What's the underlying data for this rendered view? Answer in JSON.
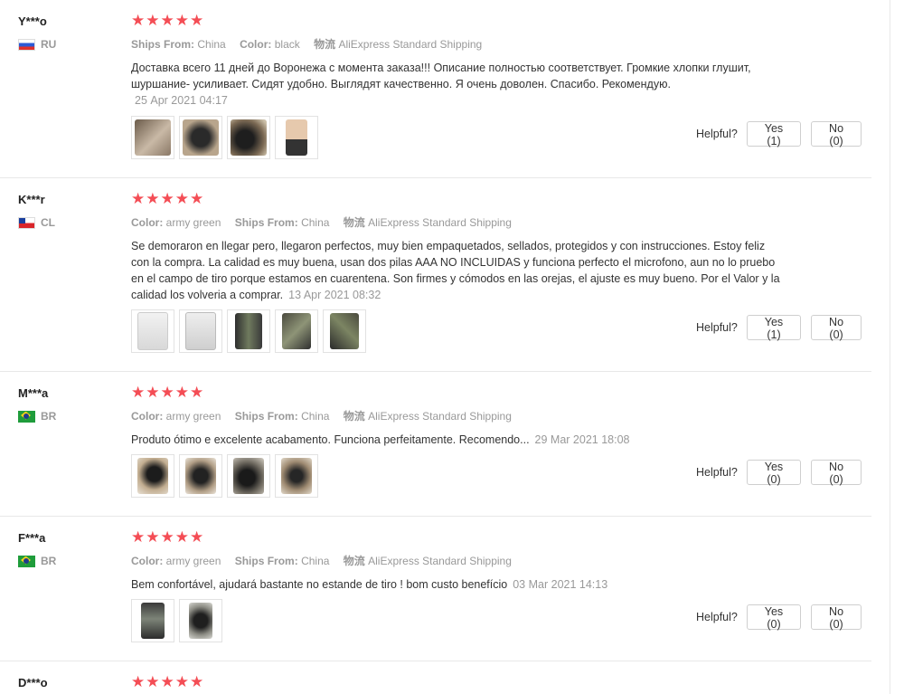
{
  "labels": {
    "ships_from": "Ships From:",
    "color": "Color:",
    "shipping_icon": "物流",
    "helpful": "Helpful?"
  },
  "colors": {
    "star": "#f44d55",
    "meta_text": "#999999",
    "border": "#e8e8e8"
  },
  "reviews": [
    {
      "user": "Y***o",
      "country": "RU",
      "stars": "★★★★★",
      "meta": [
        {
          "label": "Ships From:",
          "value": "China"
        },
        {
          "label": "Color:",
          "value": "black"
        }
      ],
      "shipping": "AliExpress Standard Shipping",
      "text": "Доставка всего 11 дней до Воронежа с момента заказа!!! Описание полностью соответствует. Громкие хлопки глушит, шуршание- усиливает. Сидят удобно. Выглядят качественно. Я очень доволен. Спасибо. Рекомендую.",
      "date": "25 Apr 2021 04:17",
      "photos": 4,
      "yes": "Yes (1)",
      "no": "No (0)"
    },
    {
      "user": "K***r",
      "country": "CL",
      "stars": "★★★★★",
      "meta": [
        {
          "label": "Color:",
          "value": "army green"
        },
        {
          "label": "Ships From:",
          "value": "China"
        }
      ],
      "shipping": "AliExpress Standard Shipping",
      "text": "Se demoraron en llegar pero, llegaron perfectos, muy bien empaquetados, sellados, protegidos y con instrucciones. Estoy feliz con la compra. La calidad es muy buena, usan dos pilas AAA NO INCLUIDAS y funciona perfecto el microfono, aun no lo pruebo en el campo de tiro porque estamos en cuarentena. Son firmes y cómodos en las orejas, el ajuste es muy bueno. Por el Valor y la calidad los volveria a comprar.",
      "date": "13 Apr 2021 08:32",
      "photos": 5,
      "yes": "Yes (1)",
      "no": "No (0)"
    },
    {
      "user": "M***a",
      "country": "BR",
      "stars": "★★★★★",
      "meta": [
        {
          "label": "Color:",
          "value": "army green"
        },
        {
          "label": "Ships From:",
          "value": "China"
        }
      ],
      "shipping": "AliExpress Standard Shipping",
      "text": "Produto ótimo e excelente acabamento. Funciona perfeitamente. Recomendo...",
      "date": "29 Mar 2021 18:08",
      "photos": 4,
      "yes": "Yes (0)",
      "no": "No (0)"
    },
    {
      "user": "F***a",
      "country": "BR",
      "stars": "★★★★★",
      "meta": [
        {
          "label": "Color:",
          "value": "army green"
        },
        {
          "label": "Ships From:",
          "value": "China"
        }
      ],
      "shipping": "AliExpress Standard Shipping",
      "text": "Bem confortável, ajudará bastante no estande de tiro ! bom custo benefício",
      "date": "03 Mar 2021 14:13",
      "photos": 2,
      "yes": "Yes (0)",
      "no": "No (0)"
    },
    {
      "user": "D***o",
      "stars": "★★★★★"
    }
  ]
}
